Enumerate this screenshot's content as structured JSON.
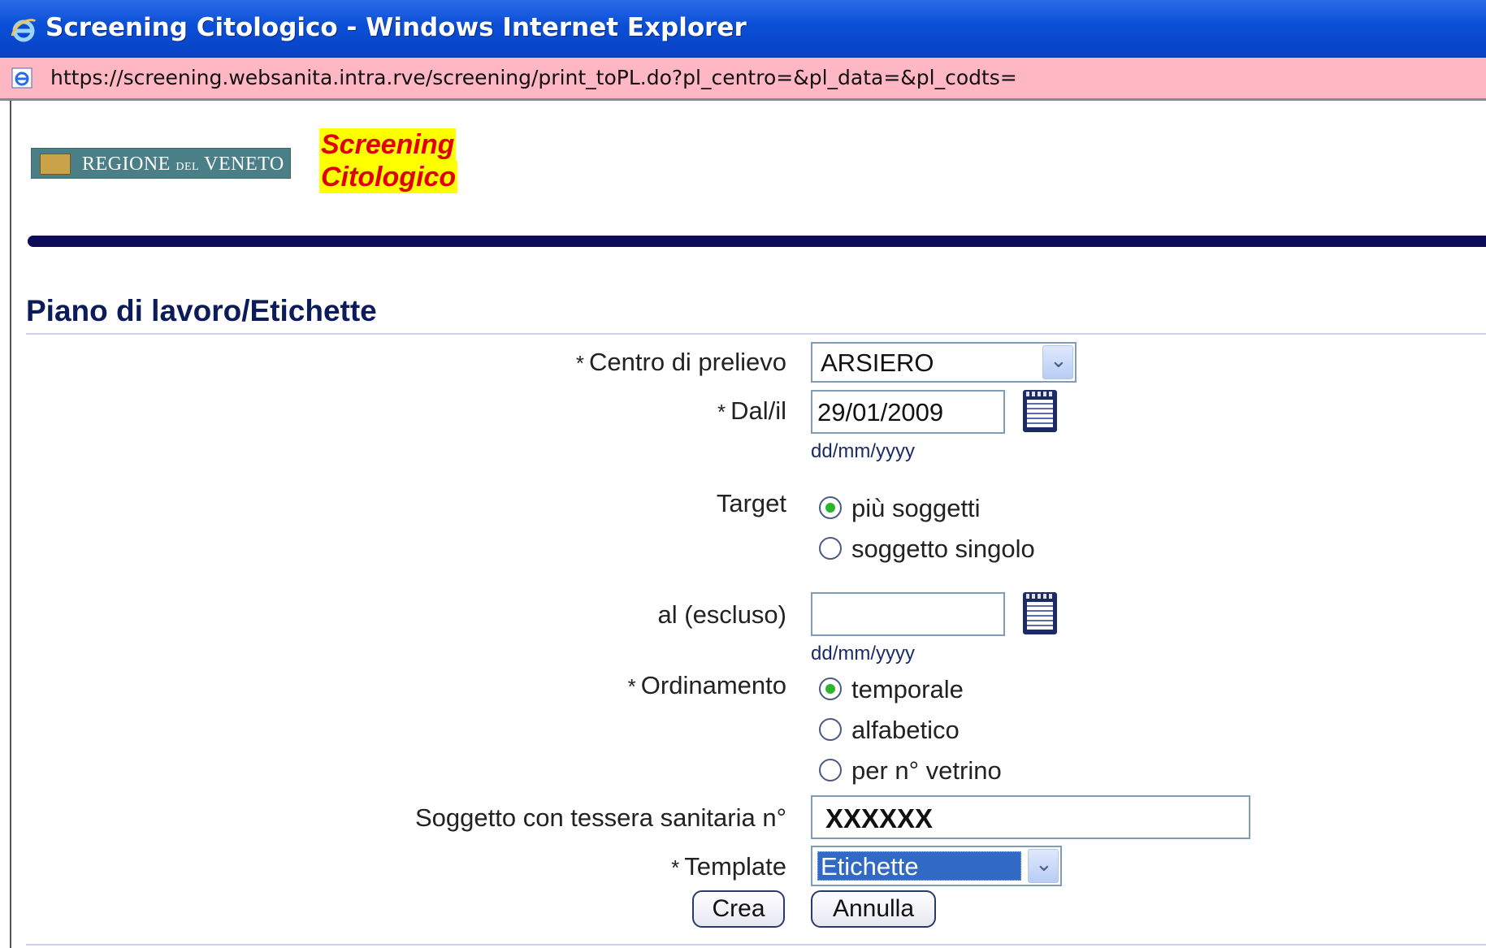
{
  "window": {
    "title": "Screening Citologico - Windows Internet Explorer",
    "url": "https://screening.websanita.intra.rve/screening/print_toPL.do?pl_centro=&pl_data=&pl_codts="
  },
  "header": {
    "logo_text_a": "REGIONE",
    "logo_text_b": "DEL",
    "logo_text_c": "VENETO",
    "app_title_line1": "Screening",
    "app_title_line2": "Citologico"
  },
  "page": {
    "title": "Piano di lavoro/Etichette"
  },
  "form": {
    "required_mark": "*",
    "centro": {
      "label": "Centro di prelievo",
      "value": "ARSIERO"
    },
    "dal": {
      "label": "Dal/il",
      "value": "29/01/2009",
      "hint": "dd/mm/yyyy"
    },
    "target": {
      "label": "Target",
      "options": [
        {
          "label": "più soggetti",
          "selected": true
        },
        {
          "label": "soggetto singolo",
          "selected": false
        }
      ]
    },
    "al": {
      "label": "al (escluso)",
      "value": "",
      "hint": "dd/mm/yyyy"
    },
    "ordinamento": {
      "label": "Ordinamento",
      "options": [
        {
          "label": "temporale",
          "selected": true
        },
        {
          "label": "alfabetico",
          "selected": false
        },
        {
          "label": "per n° vetrino",
          "selected": false
        }
      ]
    },
    "tessera": {
      "label": "Soggetto con tessera sanitaria n°",
      "value": "XXXXXX"
    },
    "template": {
      "label": "Template",
      "value": "Etichette"
    },
    "buttons": {
      "create": "Crea",
      "cancel": "Annulla"
    }
  }
}
